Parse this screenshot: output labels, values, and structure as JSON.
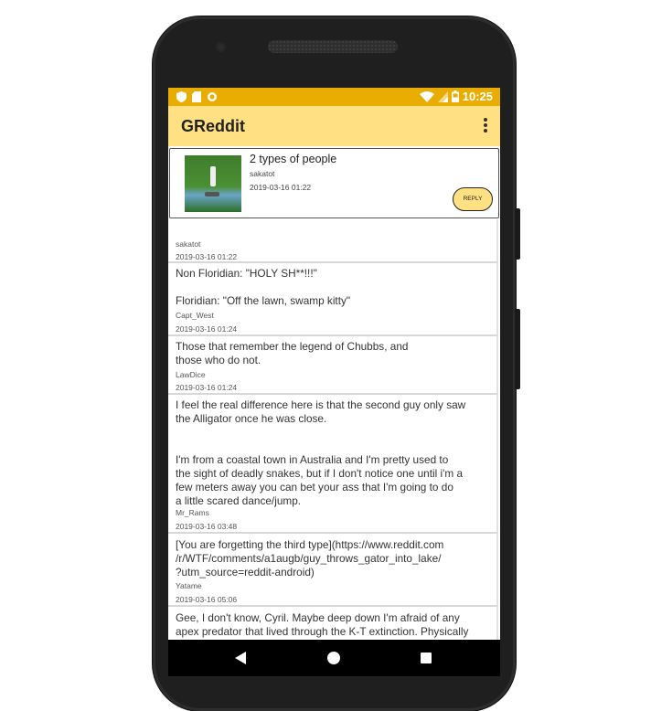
{
  "status_bar": {
    "time": "10:25"
  },
  "app_bar": {
    "title": "GReddit"
  },
  "post": {
    "title": "2 types of people",
    "author": "sakatot",
    "timestamp": "2019-03-16 01:22",
    "reply_label": "REPLY"
  },
  "comments": [
    {
      "text": "",
      "author": "sakatot",
      "timestamp": "2019-03-16 01:22"
    },
    {
      "text": "Non Floridian: \"HOLY SH**!!!\"\n\nFloridian: \"Off the lawn, swamp kitty\"",
      "author": "Capt_West",
      "timestamp": "2019-03-16 01:24"
    },
    {
      "text": "Those that remember the legend of Chubbs, and\nthose who do not.",
      "author": "LawDice",
      "timestamp": "2019-03-16 01:24"
    },
    {
      "text": "I feel the real difference here is that the second guy only saw\nthe Alligator once he was close.\n\n\nI'm from a coastal town in Australia and I'm pretty used to\nthe sight of deadly snakes, but if I don't notice one until i'm a\nfew meters away you can bet your ass that I'm going to do\na little scared dance/jump.",
      "author": "Mr_Rams",
      "timestamp": "2019-03-16 03:48"
    },
    {
      "text": "[You are forgetting the third type](https://www.reddit.com\n/r/WTF/comments/a1augb/guy_throws_gator_into_lake/\n?utm_source=reddit-android)",
      "author": "Yatame",
      "timestamp": "2019-03-16 05:06"
    },
    {
      "text": " Gee, I don't know, Cyril. Maybe deep down I'm afraid of any\napex predator that lived through the K-T extinction. Physically",
      "author": "",
      "timestamp": ""
    }
  ],
  "icons": {
    "status_left": [
      "shield-icon",
      "sd-card-icon",
      "sync-icon"
    ],
    "status_right": [
      "wifi-icon",
      "signal-icon",
      "battery-icon"
    ],
    "nav": [
      "back-icon",
      "home-icon",
      "recents-icon"
    ]
  },
  "colors": {
    "status_bar": "#e8ad00",
    "app_bar": "#ffe082",
    "reply_button": "#ffe082",
    "nav_bar": "#000000"
  }
}
